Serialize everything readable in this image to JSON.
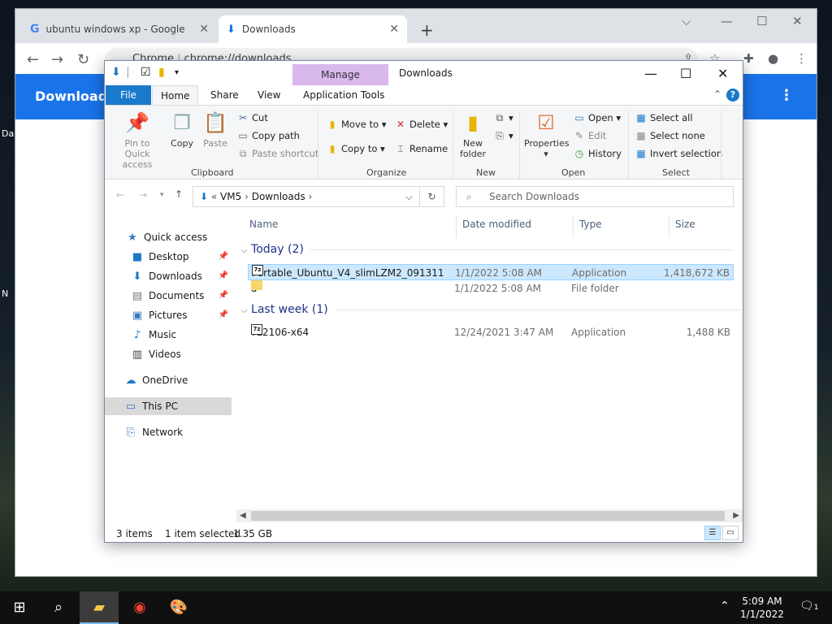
{
  "desktop": {
    "label1": "Da",
    "label2": "N"
  },
  "chrome": {
    "tabs": [
      {
        "title": "ubuntu windows xp - Google Se"
      },
      {
        "title": "Downloads"
      }
    ],
    "omnibox": {
      "prefix": "Chrome",
      "url": "chrome://downloads"
    },
    "page_title": "Downloads"
  },
  "explorer": {
    "title": "Downloads",
    "manage_label": "Manage",
    "ribbon_tabs": {
      "file": "File",
      "home": "Home",
      "share": "Share",
      "view": "View",
      "app_tools": "Application Tools"
    },
    "clipboard": {
      "label": "Clipboard",
      "pin": "Pin to Quick access",
      "copy": "Copy",
      "paste": "Paste",
      "cut": "Cut",
      "copy_path": "Copy path",
      "paste_shortcut": "Paste shortcut"
    },
    "organize": {
      "label": "Organize",
      "move_to": "Move to",
      "copy_to": "Copy to",
      "delete": "Delete",
      "rename": "Rename"
    },
    "new": {
      "label": "New",
      "new_folder": "New folder"
    },
    "open": {
      "label": "Open",
      "properties": "Properties",
      "open": "Open",
      "edit": "Edit",
      "history": "History"
    },
    "select": {
      "label": "Select",
      "select_all": "Select all",
      "select_none": "Select none",
      "invert": "Invert selection"
    },
    "address": {
      "root": "VM5",
      "current": "Downloads"
    },
    "search_placeholder": "Search Downloads",
    "nav": {
      "quick_access": "Quick access",
      "desktop": "Desktop",
      "downloads": "Downloads",
      "documents": "Documents",
      "pictures": "Pictures",
      "music": "Music",
      "videos": "Videos",
      "onedrive": "OneDrive",
      "this_pc": "This PC",
      "network": "Network"
    },
    "columns": {
      "name": "Name",
      "date": "Date modified",
      "type": "Type",
      "size": "Size"
    },
    "groups": {
      "today": "Today (2)",
      "last_week": "Last week (1)"
    },
    "files": [
      {
        "name": "Portable_Ubuntu_V4_slimLZM2_091311",
        "date": "1/1/2022 5:08 AM",
        "type": "Application",
        "size": "1,418,672 KB",
        "icon": "7z-icon"
      },
      {
        "name": "a",
        "date": "1/1/2022 5:08 AM",
        "type": "File folder",
        "size": "",
        "icon": "folder-icon"
      },
      {
        "name": "7z2106-x64",
        "date": "12/24/2021 3:47 AM",
        "type": "Application",
        "size": "1,488 KB",
        "icon": "7z-icon"
      }
    ],
    "status": {
      "items": "3 items",
      "selected": "1 item selected",
      "size": "1.35 GB"
    }
  },
  "taskbar": {
    "time": "5:09 AM",
    "date": "1/1/2022",
    "notification_count": "1"
  }
}
